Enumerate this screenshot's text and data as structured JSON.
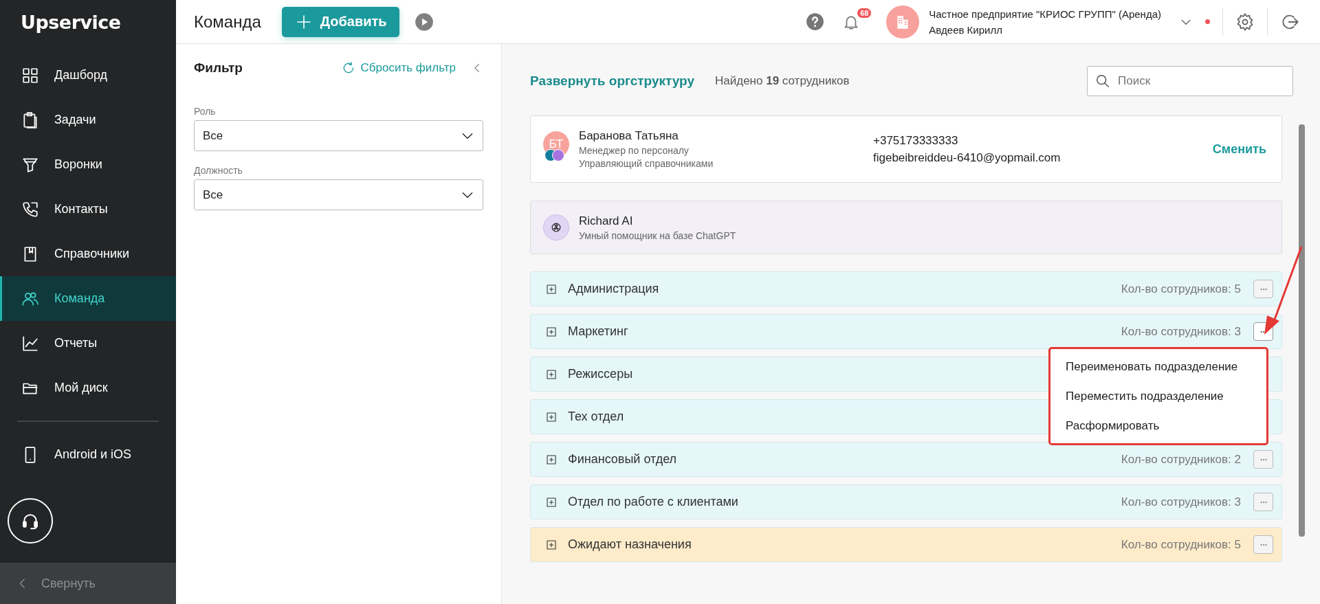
{
  "sidebar": {
    "logo": "Upservice",
    "items": [
      {
        "label": "Дашборд",
        "selected": false
      },
      {
        "label": "Задачи",
        "selected": false
      },
      {
        "label": "Воронки",
        "selected": false
      },
      {
        "label": "Контакты",
        "selected": false
      },
      {
        "label": "Справочники",
        "selected": false
      },
      {
        "label": "Команда",
        "selected": true
      },
      {
        "label": "Отчеты",
        "selected": false
      },
      {
        "label": "Мой диск",
        "selected": false
      }
    ],
    "extra_item": "Android и iOS",
    "collapse": "Свернуть"
  },
  "header": {
    "title": "Команда",
    "add_button": "Добавить",
    "notifications_badge": "68",
    "company": "Частное предприятие \"КРИОС ГРУПП\" (Аренда)",
    "user": "Авдеев Кирилл"
  },
  "filter": {
    "title": "Фильтр",
    "reset": "Сбросить фильтр",
    "fields": [
      {
        "label": "Роль",
        "value": "Все"
      },
      {
        "label": "Должность",
        "value": "Все"
      }
    ]
  },
  "team": {
    "expand_link": "Развернуть оргструктуру",
    "found": "Найдено **19** сотрудников",
    "search": {
      "placeholder": "Поиск"
    },
    "manager": {
      "initials": "БТ",
      "name": "Баранова Татьяна",
      "roles": [
        "Менеджер по персоналу",
        "Управляющий справочниками"
      ],
      "phone": "+375173333333",
      "email": "figebeibreiddeu-6410@yopmail.com",
      "action": "Сменить"
    },
    "assistant": {
      "name": "Richard AI",
      "description": "Умный помощник на базе ChatGPT"
    },
    "departments": [
      {
        "name": "Администрация",
        "count": "Кол-во сотрудников: 5",
        "color": "#e6f7fa"
      },
      {
        "name": "Маркетинг",
        "count": "Кол-во сотрудников: 3",
        "color": "#e6f7fa",
        "menu_open": true
      },
      {
        "name": "Режиссеры",
        "color": "#e6f7fa"
      },
      {
        "name": "Тех отдел",
        "color": "#e6f7fa"
      },
      {
        "name": "Финансовый отдел",
        "count": "Кол-во сотрудников: 2",
        "color": "#e6f7fa"
      },
      {
        "name": "Отдел по работе с клиентами",
        "count": "Кол-во сотрудников: 3",
        "color": "#e6f7fa"
      },
      {
        "name": "Ожидают назначения",
        "count": "Кол-во сотрудников: 5",
        "color": "#fdebc9"
      }
    ],
    "context_menu": {
      "items": [
        "Переименовать подразделение",
        "Переместить подразделение",
        "Расформировать"
      ]
    }
  }
}
